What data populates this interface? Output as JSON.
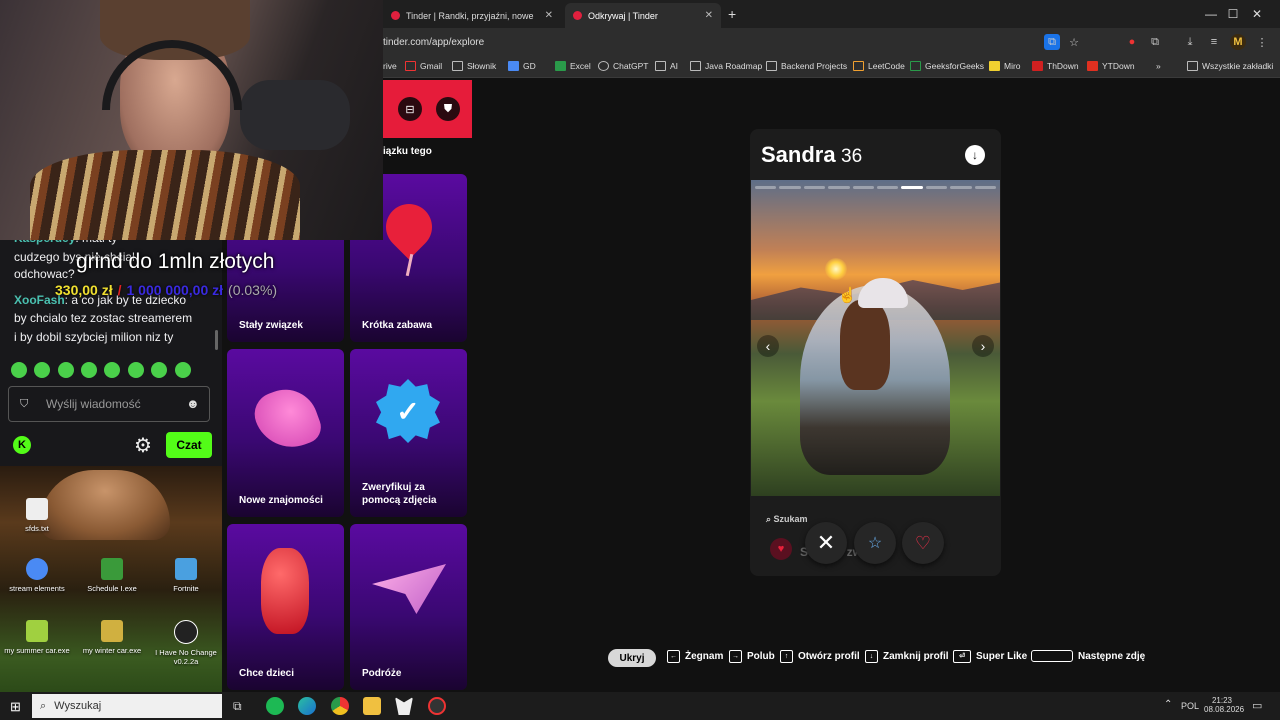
{
  "browser": {
    "tabs": [
      {
        "title": "Tinder | Randki, przyjaźni, nowe",
        "active": false
      },
      {
        "title": "Odkrywaj | Tinder",
        "active": true
      }
    ],
    "new_tab": "+",
    "url": "tinder.com/app/explore",
    "bookmarks": [
      "rive",
      "Gmail",
      "Słownik",
      "GD",
      "Excel",
      "ChatGPT",
      "AI",
      "Java Roadmap",
      "Backend Projects",
      "LeetCode",
      "GeeksforGeeks",
      "Miro",
      "ThDown",
      "YTDown"
    ],
    "bookmarks_more": "»",
    "all_bookmarks": "Wszystkie zakładki"
  },
  "stream_overlay": {
    "goal_title": "grind do 1mln złotych",
    "current": "330,00 zł",
    "separator": "/",
    "target": "1 000 000,00 zł",
    "percent": "(0.03%)"
  },
  "chat": {
    "messages": [
      {
        "user": "Kasperdey",
        "text": "mati ty"
      },
      {
        "user": "",
        "text": "cudzego bys nie chcial"
      },
      {
        "user": "",
        "text": "odchowac?"
      },
      {
        "user": "XooFash",
        "text": "a co jak by te dziecko"
      },
      {
        "user": "",
        "text": "by chcialo tez zostac streamerem"
      },
      {
        "user": "",
        "text": "i by dobil szybciej milion niz ty"
      }
    ],
    "placeholder": "Wyślij wiadomość",
    "send_label": "Czat"
  },
  "desktop": {
    "icons": [
      "sfds.txt",
      "stream elements",
      "Schedule I.exe",
      "Fortnite",
      "my summer car.exe",
      "my winter car.exe",
      "I Have No Change v0.2.2a"
    ]
  },
  "tinder": {
    "sidebar_partial_text": "iązku tego",
    "categories": [
      "Stały związek",
      "Krótka zabawa",
      "Nowe znajomości",
      "Zweryfikuj za pomocą zdjęcia",
      "Chce dzieci",
      "Podróże"
    ],
    "profile": {
      "name": "Sandra",
      "age": "36",
      "photo_count": 10,
      "current_photo": 7,
      "looking_for_label": "Szukam",
      "looking_for_value": "Stałego związku"
    }
  },
  "shortcuts": [
    {
      "key": "Ukryj"
    },
    {
      "label": "Żegnam"
    },
    {
      "label": "Polub"
    },
    {
      "label": "Otwórz profil"
    },
    {
      "label": "Zamknij profil"
    },
    {
      "label": "Super Like"
    },
    {
      "label": "Następne zdję"
    }
  ],
  "taskbar": {
    "search_placeholder": "Wyszukaj",
    "language": "POL",
    "time": "21:23",
    "date": "08.08.2026"
  },
  "colors": {
    "tinder_red": "#e61c3a",
    "kick_green": "#53fc18",
    "card_purple": "#5a0aa0"
  }
}
